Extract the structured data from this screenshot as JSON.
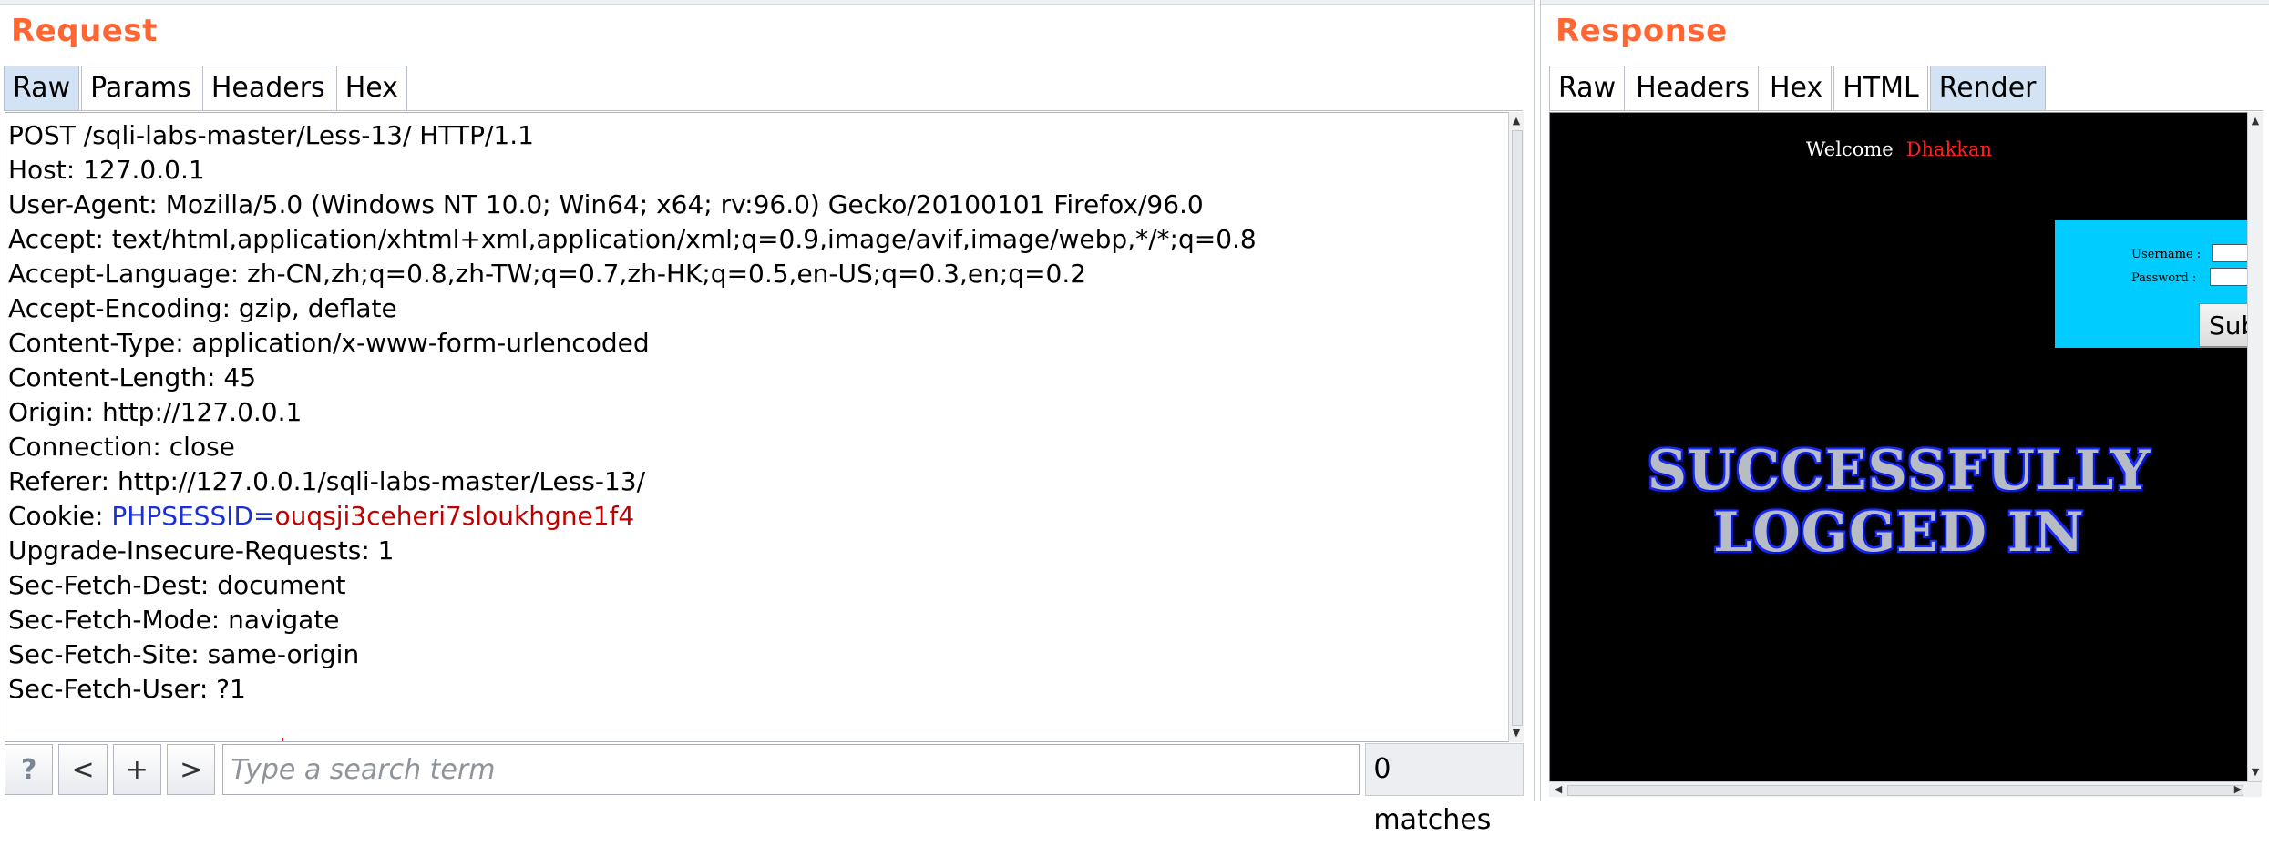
{
  "request": {
    "title": "Request",
    "tabs": [
      {
        "label": "Raw",
        "active": true
      },
      {
        "label": "Params",
        "active": false
      },
      {
        "label": "Headers",
        "active": false
      },
      {
        "label": "Hex",
        "active": false
      }
    ],
    "lines": [
      "POST /sqli-labs-master/Less-13/ HTTP/1.1",
      "Host: 127.0.0.1",
      "User-Agent: Mozilla/5.0 (Windows NT 10.0; Win64; x64; rv:96.0) Gecko/20100101 Firefox/96.0",
      "Accept: text/html,application/xhtml+xml,application/xml;q=0.9,image/avif,image/webp,*/*;q=0.8",
      "Accept-Language: zh-CN,zh;q=0.8,zh-TW;q=0.7,zh-HK;q=0.5,en-US;q=0.3,en;q=0.2",
      "Accept-Encoding: gzip, deflate",
      "Content-Type: application/x-www-form-urlencoded",
      "Content-Length: 45",
      "Origin: http://127.0.0.1",
      "Connection: close",
      "Referer: http://127.0.0.1/sqli-labs-master/Less-13/"
    ],
    "cookie": {
      "prefix": "Cookie: ",
      "name": "PHPSESSID",
      "eq": "=",
      "value": "ouqsji3ceheri7sloukhgne1f4"
    },
    "lines_after": [
      "Upgrade-Insecure-Requests: 1",
      "Sec-Fetch-Dest: document",
      "Sec-Fetch-Mode: navigate",
      "Sec-Fetch-Site: same-origin",
      "Sec-Fetch-User: ?1"
    ],
    "search": {
      "help_label": "?",
      "prev_label": "<",
      "add_label": "+",
      "next_label": ">",
      "placeholder": "Type a search term",
      "matches": "0 matches"
    }
  },
  "response": {
    "title": "Response",
    "tabs": [
      {
        "label": "Raw",
        "active": false
      },
      {
        "label": "Headers",
        "active": false
      },
      {
        "label": "Hex",
        "active": false
      },
      {
        "label": "HTML",
        "active": false
      },
      {
        "label": "Render",
        "active": true
      }
    ],
    "render": {
      "welcome": "Welcome",
      "user_name": "Dhakkan",
      "username_label": "Username :",
      "password_label": "Password :",
      "submit_label": "Submit",
      "banner_line1": "SUCCESSFULLY",
      "banner_line2": "LOGGED IN"
    }
  },
  "colors": {
    "title": "#ff6633",
    "active_tab": "#d3e3f4",
    "cookie_name": "#1a2fd8",
    "cookie_value": "#c00000",
    "login_box": "#00ccff"
  }
}
